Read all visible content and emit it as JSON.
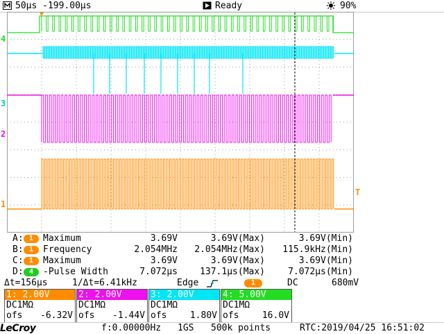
{
  "status": {
    "timebase": "50µs -199.00µs",
    "run_state": "Ready",
    "zoom": "90%"
  },
  "colors": {
    "ch1": "#ff8c00",
    "ch2": "#ee10ee",
    "ch3": "#00e6f5",
    "ch4": "#22dd22",
    "grid": "#9a9a9a"
  },
  "channel_markers": {
    "ch4": "4",
    "ch3": "3",
    "ch2": "2",
    "ch1": "1",
    "trigger": "T"
  },
  "measurements": [
    {
      "slot": "A:",
      "src": "1",
      "name": "Maximum",
      "value": "3.69V",
      "max": "3.69V(Max)",
      "min": "3.69V(Min)"
    },
    {
      "slot": "B:",
      "src": "1",
      "name": "Frequency",
      "value": "2.054MHz",
      "max": "2.054MHz(Max)",
      "min": "115.9kHz(Min)"
    },
    {
      "slot": "C:",
      "src": "1",
      "name": "Maximum",
      "value": "3.69V",
      "max": "3.69V(Max)",
      "min": "3.69V(Min)"
    },
    {
      "slot": "D:",
      "src": "4",
      "name": "-Pulse Width",
      "value": "7.072µs",
      "max": "137.1µs(Max)",
      "min": "7.072µs(Min)"
    }
  ],
  "cursor": {
    "delta_t": "Δt=156µs",
    "inv_delta_t": "1/Δt=6.41kHz",
    "trigger_type": "Edge",
    "trigger_source": "1",
    "coupling": "DC",
    "level": "680mV"
  },
  "channels": [
    {
      "head": "1: 2.00V",
      "coupling": "DC1MΩ",
      "ofs_label": "ofs",
      "ofs": "-6.32V"
    },
    {
      "head": "2: 2.00V",
      "coupling": "DC1MΩ",
      "ofs_label": "ofs",
      "ofs": "-1.44V"
    },
    {
      "head": "3: 2.00V",
      "coupling": "DC1MΩ",
      "ofs_label": "ofs",
      "ofs": "1.80V"
    },
    {
      "head": "4: 5.00V",
      "coupling": "DC1MΩ",
      "ofs_label": "ofs",
      "ofs": "16.0V"
    }
  ],
  "bottom": {
    "logo": "LeCroy",
    "freq": "f:0.00000Hz",
    "sample_rate": "1GS",
    "points": "500k points",
    "rtc": "RTC:2019/04/25 16:51:02"
  }
}
